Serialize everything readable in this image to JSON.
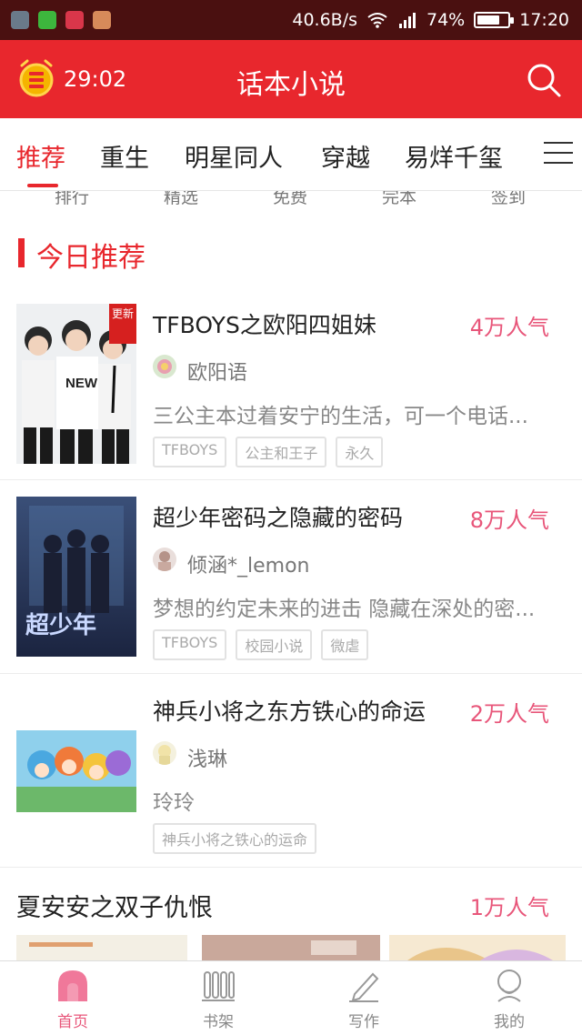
{
  "status_bar": {
    "speed": "40.6B/s",
    "battery": "74%",
    "time": "17:20",
    "battery_level": 0.74
  },
  "header": {
    "timer": "29:02",
    "title": "话本小说"
  },
  "tabs": [
    "推荐",
    "重生",
    "明星同人",
    "穿越",
    "易烊千玺"
  ],
  "quick_links": [
    "排行",
    "精选",
    "免费",
    "完本",
    "签到"
  ],
  "section_title": "今日推荐",
  "books": [
    {
      "title": "TFBOYS之欧阳四姐妹",
      "popularity": "4万人气",
      "author": "欧阳语",
      "desc": "三公主本过着安宁的生活，可一个电话...",
      "tags": [
        "TFBOYS",
        "公主和王子",
        "永久"
      ],
      "badge": "更新"
    },
    {
      "title": "超少年密码之隐藏的密码",
      "popularity": "8万人气",
      "author": "倾涵*_lemon",
      "desc": "梦想的约定未来的进击 隐藏在深处的密...",
      "tags": [
        "TFBOYS",
        "校园小说",
        "微虐"
      ]
    },
    {
      "title": "神兵小将之东方铁心的命运",
      "popularity": "2万人气",
      "author": "浅琳",
      "desc": "玲玲",
      "tags": [
        "神兵小将之铁心的运命"
      ]
    }
  ],
  "featured": {
    "title": "夏安安之双子仇恨",
    "popularity": "1万人气"
  },
  "bottom_nav": [
    "首页",
    "书架",
    "写作",
    "我的"
  ],
  "colors": {
    "accent": "#e8272d",
    "popularity": "#e8567a",
    "status_bar": "#4a1010"
  }
}
